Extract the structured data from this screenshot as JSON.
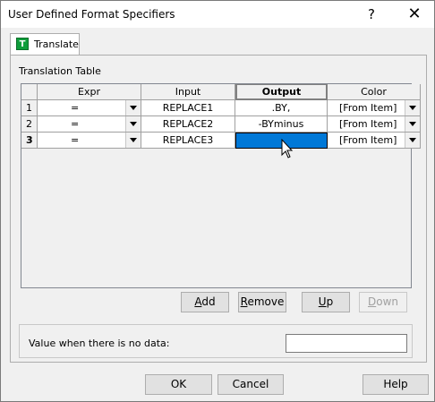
{
  "window": {
    "title": "User Defined Format Specifiers",
    "help_glyph": "?",
    "close_glyph": "✕"
  },
  "tab": {
    "icon_letter": "T",
    "label": "Translate"
  },
  "table": {
    "label": "Translation Table",
    "headers": {
      "rownum": "",
      "expr": "Expr",
      "input": "Input",
      "output": "Output",
      "color": "Color"
    },
    "rows": [
      {
        "num": "1",
        "expr": "=",
        "input": "REPLACE1",
        "output": ".BY,",
        "color": "[From Item]"
      },
      {
        "num": "2",
        "expr": "=",
        "input": "REPLACE2",
        "output": "-BYminus",
        "color": "[From Item]"
      },
      {
        "num": "3",
        "expr": "=",
        "input": "REPLACE3",
        "output": "",
        "color": "[From Item]"
      }
    ],
    "active_row": "3",
    "selected_cell": "output"
  },
  "actions": {
    "add_pre": "",
    "add_u": "A",
    "add_post": "dd",
    "remove_pre": "",
    "remove_u": "R",
    "remove_post": "emove",
    "up_pre": "",
    "up_u": "U",
    "up_post": "p",
    "down_pre": "",
    "down_u": "D",
    "down_post": "own"
  },
  "nodata": {
    "label": "Value when there is no data:",
    "value": ""
  },
  "footer": {
    "ok": "OK",
    "cancel": "Cancel",
    "help": "Help"
  },
  "colors": {
    "selection": "#0078d7",
    "tab_icon": "#0f9d3b"
  }
}
